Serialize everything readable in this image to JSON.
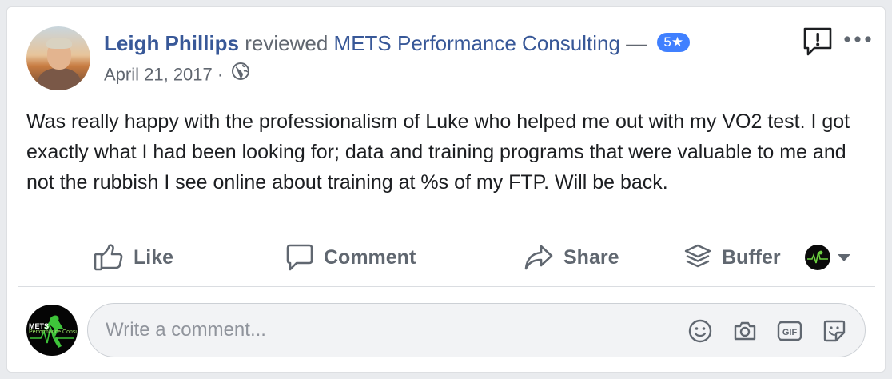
{
  "review": {
    "reviewer_name": "Leigh Phillips",
    "verb": "reviewed",
    "page_name": "METS Performance Consulting",
    "separator": "—",
    "rating_label": "5★",
    "date": "April 21, 2017",
    "date_separator": "·",
    "text": "Was really happy with the professionalism of Luke who helped me out with my VO2 test. I got exactly what I had been looking for; data and training programs that were valuable to me and not the rubbish I see online about training at %s of my FTP. Will be back."
  },
  "actions": {
    "like": "Like",
    "comment": "Comment",
    "share": "Share",
    "buffer": "Buffer"
  },
  "composer": {
    "placeholder": "Write a comment...",
    "page_avatar_text_1": "METS",
    "page_avatar_text_2": "Performance Consulting"
  },
  "colors": {
    "link": "#385898",
    "rating_badge": "#4080ff",
    "muted_text": "#606770",
    "body_text": "#1c1e21",
    "card_border": "#dddfe2"
  },
  "icons": {
    "privacy": "globe-icon",
    "report": "report-flag-icon",
    "more": "more-options-icon",
    "like": "thumbs-up-icon",
    "comment": "speech-bubble-icon",
    "share": "share-arrow-icon",
    "buffer": "buffer-layers-icon",
    "emoji": "smiley-icon",
    "camera": "camera-icon",
    "gif": "gif-icon",
    "sticker": "sticker-icon"
  }
}
